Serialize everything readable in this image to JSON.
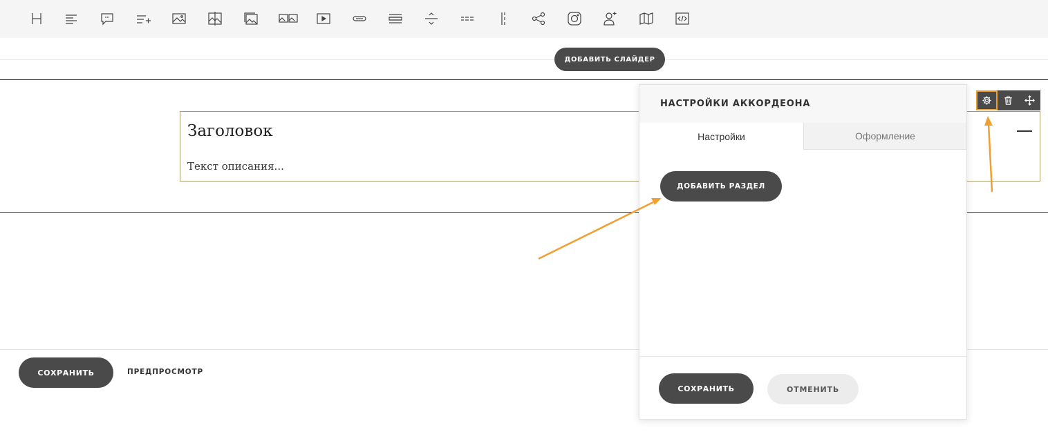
{
  "toolbar": {
    "items": [
      {
        "icon": "heading-icon"
      },
      {
        "icon": "text-icon"
      },
      {
        "icon": "quote-icon"
      },
      {
        "icon": "list-add-icon"
      },
      {
        "icon": "image-icon"
      },
      {
        "icon": "image-compare-icon"
      },
      {
        "icon": "gallery-icon"
      },
      {
        "icon": "slider-icon"
      },
      {
        "icon": "video-icon"
      },
      {
        "icon": "button-icon"
      },
      {
        "icon": "accordion-icon"
      },
      {
        "icon": "divider-icon"
      },
      {
        "icon": "dashed-line-icon"
      },
      {
        "icon": "vertical-line-icon"
      },
      {
        "icon": "share-icon"
      },
      {
        "icon": "instagram-icon"
      },
      {
        "icon": "user-add-icon"
      },
      {
        "icon": "map-icon"
      },
      {
        "icon": "code-icon"
      }
    ]
  },
  "editor": {
    "add_slider_label": "ДОБАВИТЬ СЛАЙДЕР",
    "accordion": {
      "title": "Заголовок",
      "description": "Текст описания..."
    },
    "block_tools": {
      "icons": [
        "gear-icon",
        "trash-icon",
        "move-icon"
      ]
    }
  },
  "panel": {
    "title": "НАСТРОЙКИ АККОРДЕОНА",
    "tabs": [
      {
        "label": "Настройки",
        "active": true
      },
      {
        "label": "Оформление",
        "active": false
      }
    ],
    "add_section_label": "ДОБАВИТЬ РАЗДЕЛ",
    "save_label": "СОХРАНИТЬ",
    "cancel_label": "ОТМЕНИТЬ"
  },
  "footer": {
    "save_label": "СОХРАНИТЬ",
    "preview_label": "ПРЕДПРОСМОТР"
  },
  "colors": {
    "dark_button": "#4a4a4a",
    "annotation_arrow": "#f0a030",
    "accordion_border": "#a69a6a"
  }
}
